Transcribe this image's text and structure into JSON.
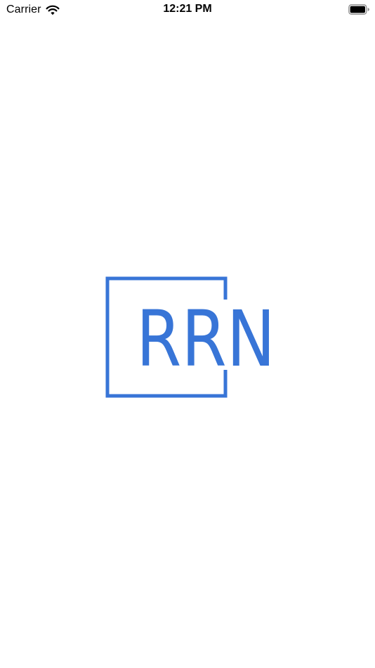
{
  "status_bar": {
    "carrier": "Carrier",
    "time": "12:21 PM",
    "wifi_icon": "wifi-icon",
    "battery_icon": "battery-full-icon"
  },
  "splash": {
    "logo_text": "RRN",
    "brand_color": "#3875D7"
  }
}
